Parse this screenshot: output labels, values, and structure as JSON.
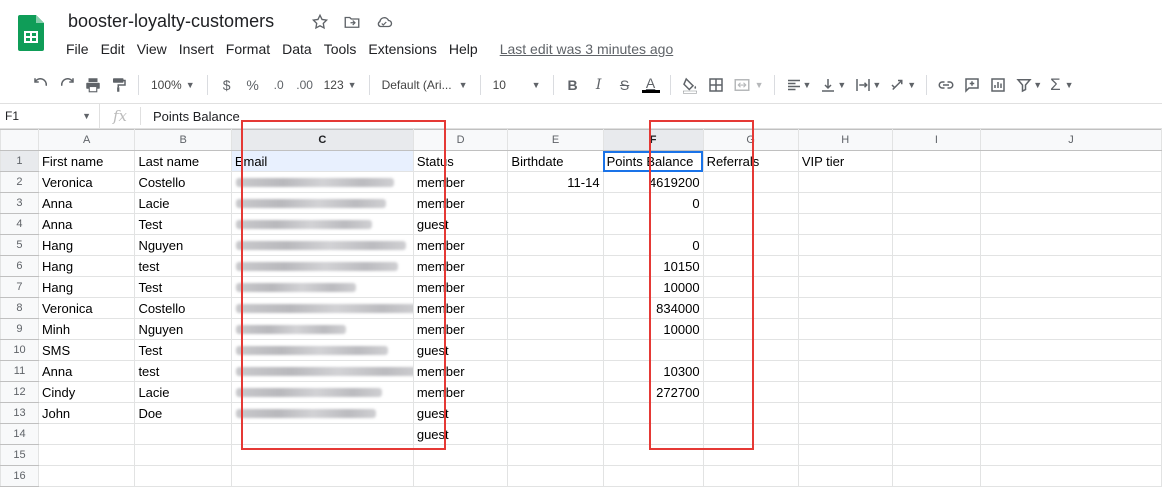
{
  "doc": {
    "title": "booster-loyalty-customers"
  },
  "menu": [
    "File",
    "Edit",
    "View",
    "Insert",
    "Format",
    "Data",
    "Tools",
    "Extensions",
    "Help"
  ],
  "last_edit": "Last edit was 3 minutes ago",
  "toolbar": {
    "zoom": "100%",
    "currency": "$",
    "percent": "%",
    "decrease_decimals": ".0",
    "increase_decimals": ".00",
    "more_formats": "123",
    "font": "Default (Ari...",
    "font_size": "10"
  },
  "formula_bar": {
    "cell_ref": "F1",
    "content": "Points Balance"
  },
  "sheet": {
    "columns": [
      "A",
      "B",
      "C",
      "D",
      "E",
      "F",
      "G",
      "H",
      "I",
      "J"
    ],
    "row_numbers": [
      "1",
      "2",
      "3",
      "4",
      "5",
      "6",
      "7",
      "8",
      "9",
      "10",
      "11",
      "12",
      "13",
      "14",
      "15",
      "16"
    ],
    "rows": [
      [
        "First name",
        "Last name",
        "Email",
        "Status",
        "Birthdate",
        "Points Balance",
        "Referrals",
        "VIP tier",
        "",
        ""
      ],
      [
        "Veronica",
        "Costello",
        "",
        "member",
        "11-14",
        "4619200",
        "",
        "",
        "",
        ""
      ],
      [
        "Anna",
        "Lacie",
        "",
        "member",
        "",
        "0",
        "",
        "",
        "",
        ""
      ],
      [
        "Anna",
        "Test",
        "",
        "guest",
        "",
        "",
        "",
        "",
        "",
        ""
      ],
      [
        "Hang",
        "Nguyen",
        "",
        "member",
        "",
        "0",
        "",
        "",
        "",
        ""
      ],
      [
        "Hang",
        "test",
        "",
        "member",
        "",
        "10150",
        "",
        "",
        "",
        ""
      ],
      [
        "Hang",
        "Test",
        "",
        "member",
        "",
        "10000",
        "",
        "",
        "",
        ""
      ],
      [
        "Veronica",
        "Costello",
        "",
        "member",
        "",
        "834000",
        "",
        "",
        "",
        ""
      ],
      [
        "Minh",
        "Nguyen",
        "",
        "member",
        "",
        "10000",
        "",
        "",
        "",
        ""
      ],
      [
        "SMS",
        "Test",
        "",
        "guest",
        "",
        "",
        "",
        "",
        "",
        ""
      ],
      [
        "Anna",
        "test",
        "",
        "member",
        "",
        "10300",
        "",
        "",
        "",
        ""
      ],
      [
        "Cindy",
        "Lacie",
        "",
        "member",
        "",
        "272700",
        "",
        "",
        "",
        ""
      ],
      [
        "John",
        "Doe",
        "",
        "guest",
        "",
        "",
        "",
        "",
        "",
        ""
      ],
      [
        "",
        "",
        "",
        "guest",
        "",
        "",
        "",
        "",
        "",
        ""
      ],
      [
        "",
        "",
        "",
        "",
        "",
        "",
        "",
        "",
        "",
        ""
      ],
      [
        "",
        "",
        "",
        "",
        "",
        "",
        "",
        "",
        "",
        ""
      ]
    ]
  },
  "colors": {
    "accent": "#1a73e8",
    "highlight": "#e53935",
    "logo": "#0f9d58"
  }
}
